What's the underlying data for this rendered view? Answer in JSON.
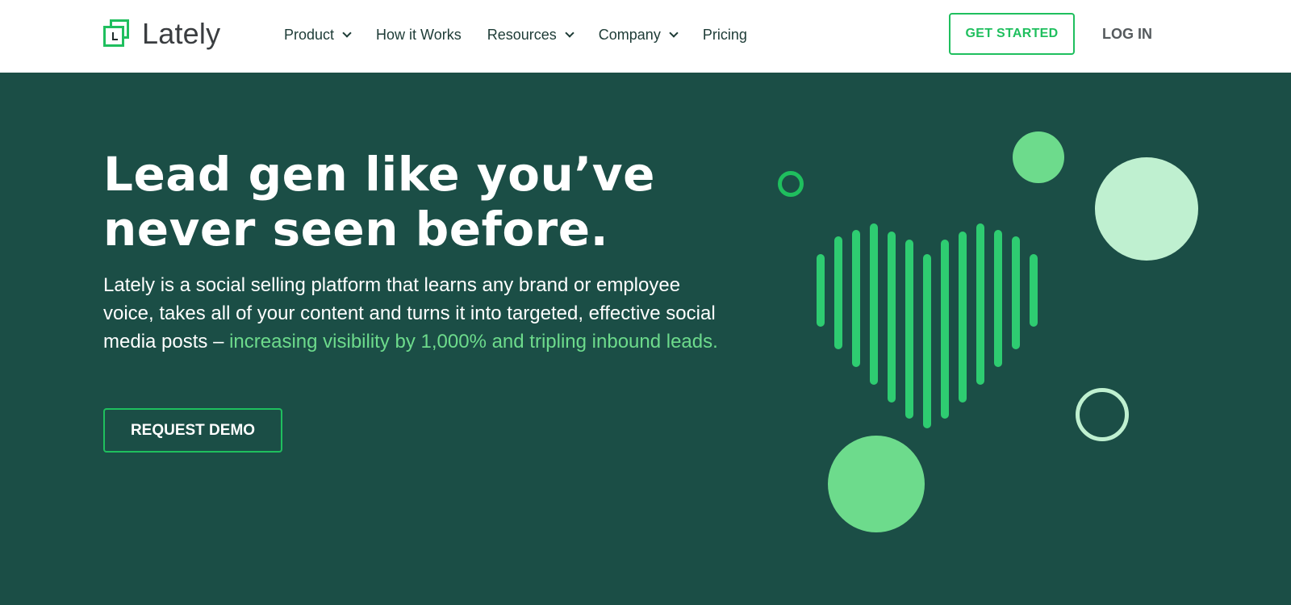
{
  "brand": {
    "name": "Lately",
    "accent": "#1fbf5e",
    "hero_bg": "#1b4e46",
    "highlight": "#6ddb8c"
  },
  "nav": {
    "items": [
      {
        "label": "Product",
        "has_dropdown": true
      },
      {
        "label": "How it Works",
        "has_dropdown": false
      },
      {
        "label": "Resources",
        "has_dropdown": true
      },
      {
        "label": "Company",
        "has_dropdown": true
      },
      {
        "label": "Pricing",
        "has_dropdown": false
      }
    ],
    "get_started": "GET STARTED",
    "login": "LOG IN"
  },
  "hero": {
    "title_line1": "Lead gen like you’ve",
    "title_line2": "never seen before.",
    "desc_plain": "Lately is a social selling platform that learns any brand or employee voice, takes all of your content and turns it into targeted, effective social media posts – ",
    "desc_highlight": "increasing visibility by 1,000% and tripling inbound leads.",
    "cta": "REQUEST DEMO"
  },
  "illustration": {
    "icon": "heart-soundwave-icon"
  }
}
